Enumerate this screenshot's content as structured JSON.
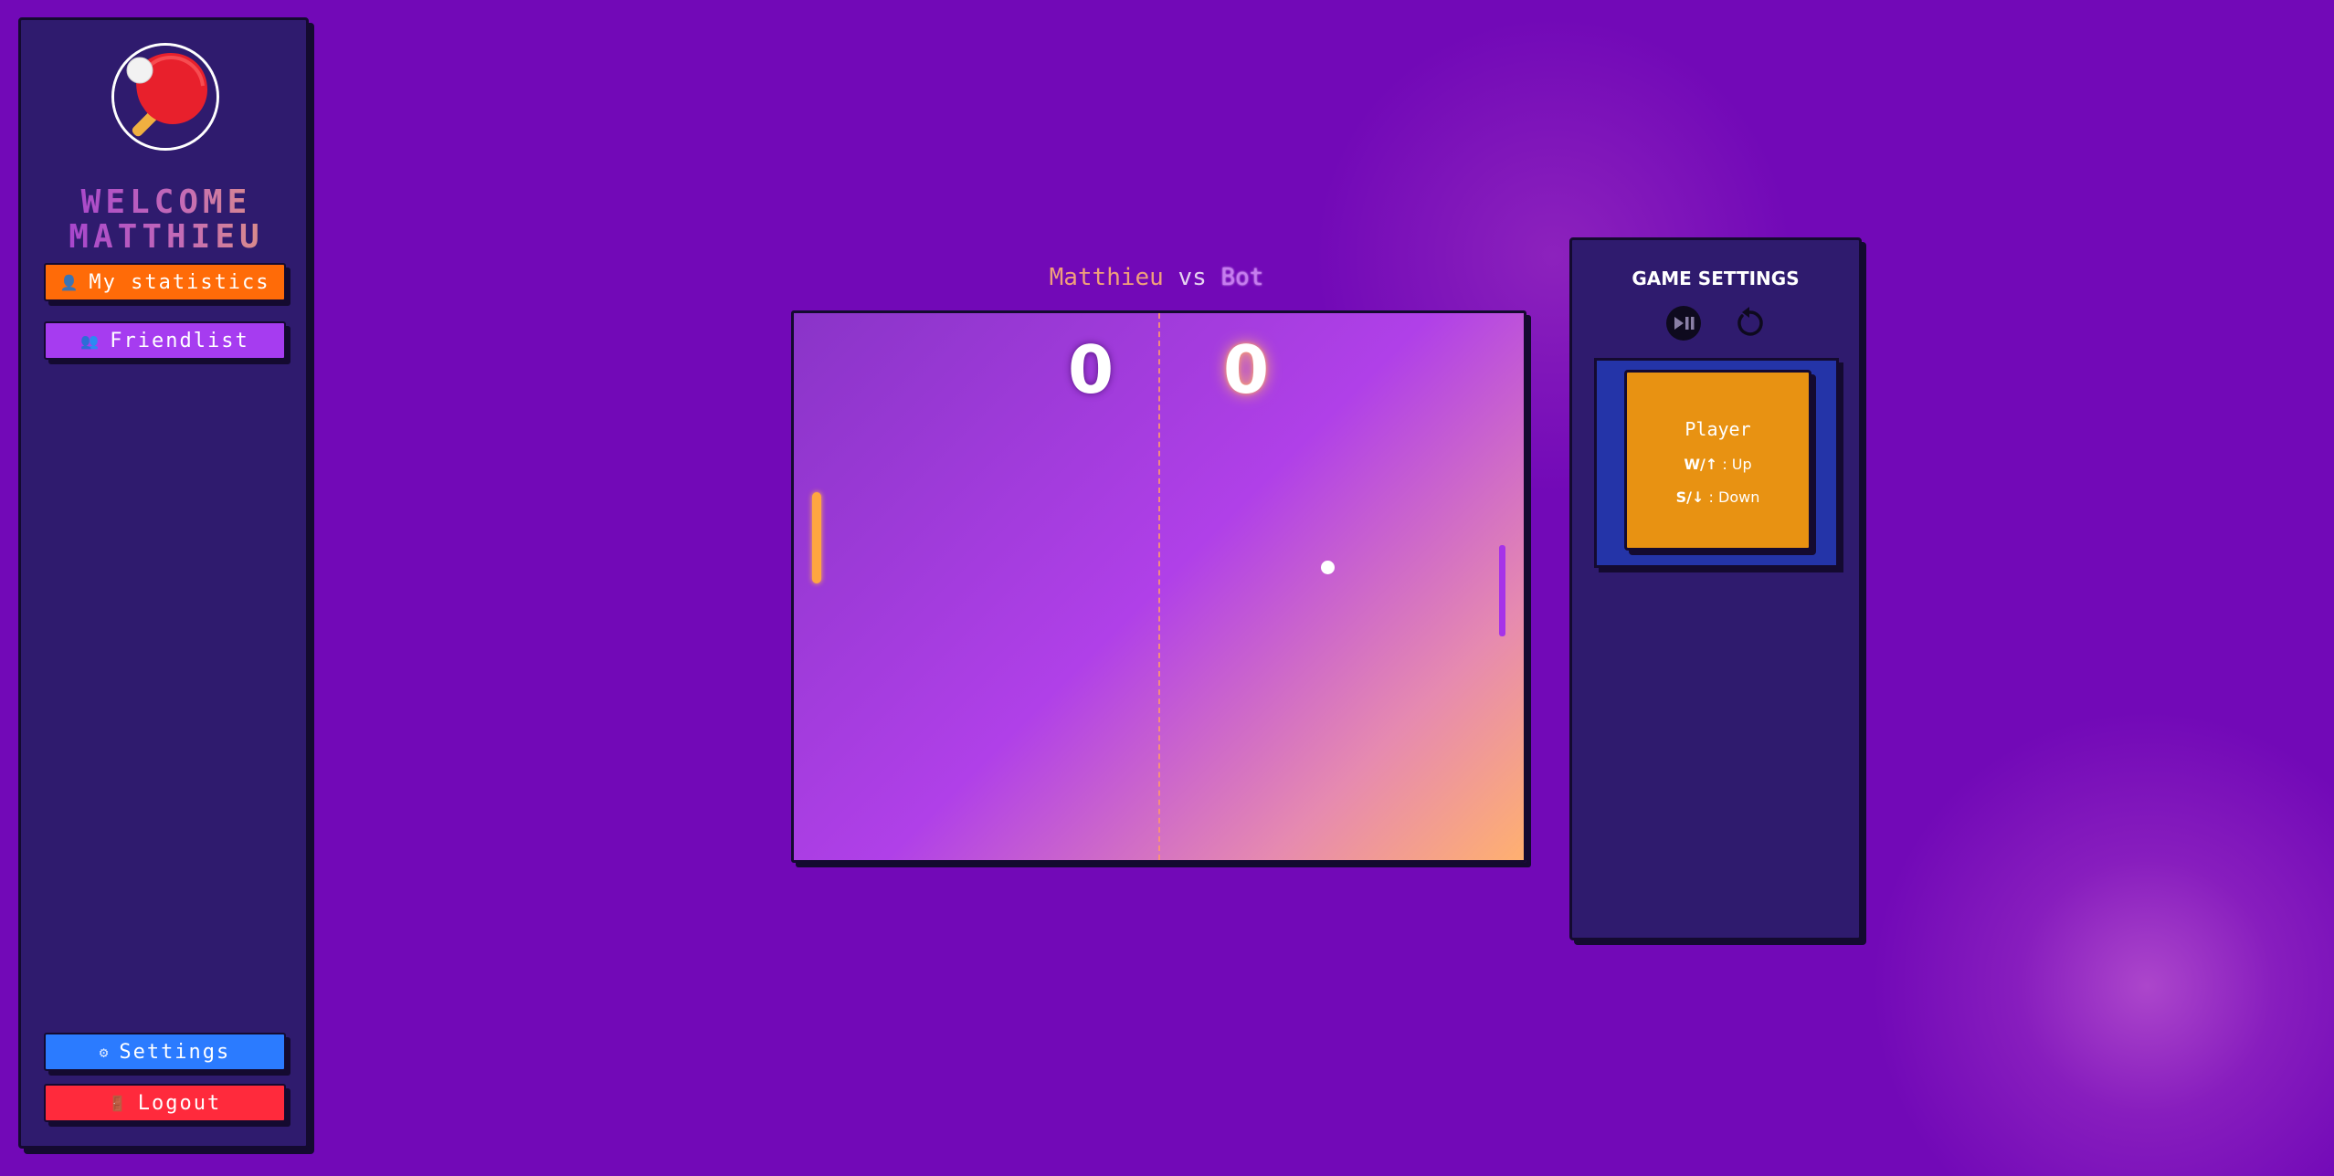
{
  "sidebar": {
    "welcome_line1": "WELCOME",
    "welcome_line2": "MATTHIEU",
    "avatar_icon": "ping-pong-paddle-icon",
    "buttons": {
      "stats_label": "My statistics",
      "friends_label": "Friendlist",
      "settings_label": "Settings",
      "logout_label": "Logout"
    }
  },
  "game": {
    "player1": "Matthieu",
    "vs": "vs",
    "player2": "Bot",
    "score_left": "0",
    "score_right": "0"
  },
  "settings_panel": {
    "title": "GAME SETTINGS",
    "play_pause_icon": "play-pause-icon",
    "reset_icon": "reset-icon",
    "player_card": {
      "title": "Player",
      "up_keys": "W/↑",
      "up_action": ": Up",
      "down_keys": "S/↓",
      "down_action": ": Down"
    }
  },
  "colors": {
    "background": "#7209b7",
    "panel": "#2f1b6e",
    "stats_button": "#ff6b08",
    "friends_button": "#a63cf0",
    "settings_button": "#2b7bff",
    "logout_button": "#ff2a3c",
    "player_card": "#e89212",
    "controls_box": "#2434a8"
  }
}
